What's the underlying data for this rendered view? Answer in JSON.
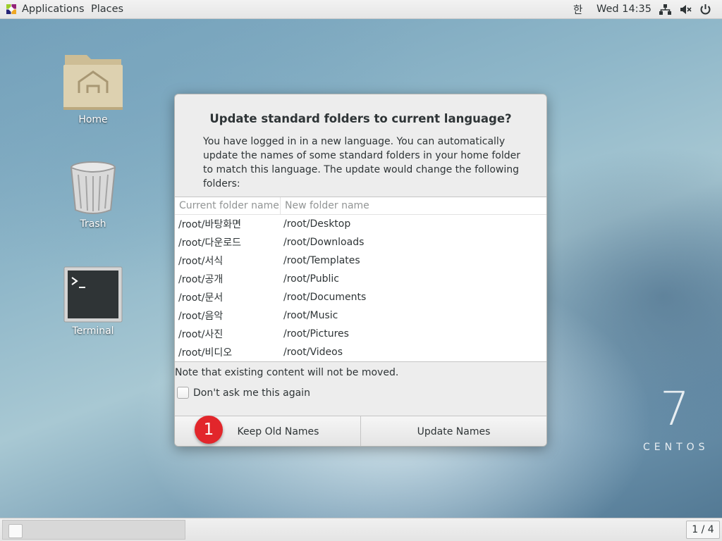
{
  "topbar": {
    "applications_label": "Applications",
    "places_label": "Places",
    "language_indicator": "한",
    "clock": "Wed 14:35",
    "icons": [
      "network-icon",
      "volume-muted-icon",
      "power-icon"
    ]
  },
  "desktop": {
    "icons": [
      {
        "label": "Home",
        "icon": "home-folder-icon"
      },
      {
        "label": "Trash",
        "icon": "trash-icon"
      },
      {
        "label": "Terminal",
        "icon": "terminal-icon"
      }
    ]
  },
  "dialog": {
    "title": "Update standard folders to current language?",
    "description": "You have logged in in a new language. You can automatically update the names of some standard folders in your home folder to match this language. The update would change the following folders:",
    "table": {
      "columns": [
        "Current folder name",
        "New folder name"
      ],
      "rows": [
        [
          "/root/바탕화면",
          "/root/Desktop"
        ],
        [
          "/root/다운로드",
          "/root/Downloads"
        ],
        [
          "/root/서식",
          "/root/Templates"
        ],
        [
          "/root/공개",
          "/root/Public"
        ],
        [
          "/root/문서",
          "/root/Documents"
        ],
        [
          "/root/음악",
          "/root/Music"
        ],
        [
          "/root/사진",
          "/root/Pictures"
        ],
        [
          "/root/비디오",
          "/root/Videos"
        ]
      ]
    },
    "note": "Note that existing content will not be moved.",
    "dont_ask_label": "Don't ask me this again",
    "dont_ask_checked": false,
    "keep_button": "Keep Old Names",
    "update_button": "Update Names"
  },
  "annotation": {
    "step_number": "1",
    "color": "#e2262b"
  },
  "watermark": {
    "number": "7",
    "word": "CENTOS"
  },
  "bottombar": {
    "workspace": "1 / 4"
  }
}
